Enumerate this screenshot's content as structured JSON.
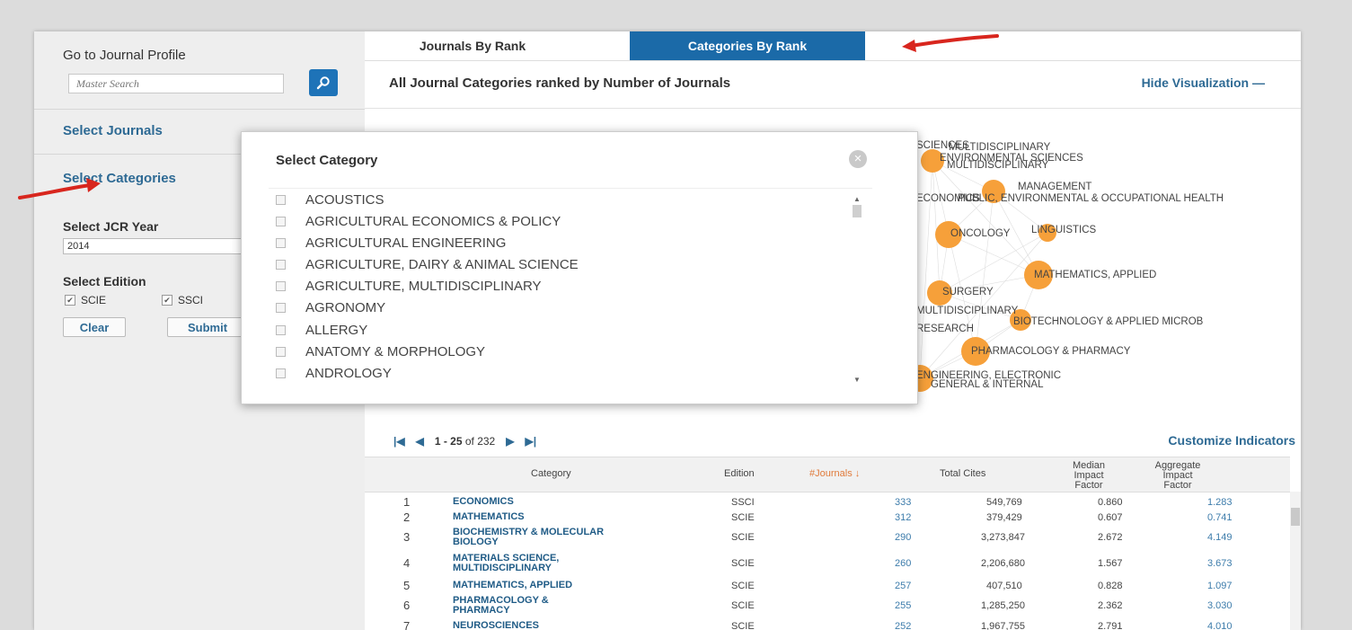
{
  "sidebar": {
    "go_to_profile": "Go to Journal Profile",
    "search_placeholder": "Master Search",
    "select_journals": "Select Journals",
    "select_categories": "Select Categories",
    "select_year_label": "Select JCR Year",
    "year_value": "2014",
    "select_edition_label": "Select Edition",
    "editions": [
      {
        "label": "SCIE",
        "checked": true
      },
      {
        "label": "SSCI",
        "checked": true
      }
    ],
    "clear_label": "Clear",
    "submit_label": "Submit"
  },
  "tabs": [
    {
      "label": "Journals By Rank",
      "active": false
    },
    {
      "label": "Categories By Rank",
      "active": true
    }
  ],
  "main": {
    "title": "All Journal Categories ranked by Number of Journals",
    "hide_visualization": "Hide Visualization —",
    "customize_indicators": "Customize Indicators"
  },
  "pager": {
    "range": "1 - 25",
    "of": "of 232"
  },
  "viz_labels": [
    "SCIENCES",
    "MULTIDISCIPLINARY",
    "ENVIRONMENTAL SCIENCES",
    "MULTIDISCIPLINARY",
    "MANAGEMENT",
    "ECONOMICS",
    "PUBLIC, ENVIRONMENTAL & OCCUPATIONAL HEALTH",
    "ONCOLOGY",
    "LINGUISTICS",
    "MATHEMATICS, APPLIED",
    "SURGERY",
    "MULTIDISCIPLINARY",
    "BIOTECHNOLOGY & APPLIED MICROB",
    "RESEARCH",
    "PHARMACOLOGY & PHARMACY",
    "ENGINEERING, ELECTRONIC",
    "GENERAL & INTERNAL"
  ],
  "table": {
    "headers": {
      "category": "Category",
      "edition": "Edition",
      "journals": "#Journals ↓",
      "total_cites": "Total Cites",
      "median_if": "Median Impact Factor",
      "aggregate_if": "Aggregate Impact Factor"
    },
    "rows": [
      {
        "rank": "1",
        "category": "ECONOMICS",
        "edition": "SSCI",
        "journals": "333",
        "total_cites": "549,769",
        "median": "0.860",
        "aggregate": "1.283"
      },
      {
        "rank": "2",
        "category": "MATHEMATICS",
        "edition": "SCIE",
        "journals": "312",
        "total_cites": "379,429",
        "median": "0.607",
        "aggregate": "0.741"
      },
      {
        "rank": "3",
        "category": "BIOCHEMISTRY & MOLECULAR BIOLOGY",
        "edition": "SCIE",
        "journals": "290",
        "total_cites": "3,273,847",
        "median": "2.672",
        "aggregate": "4.149"
      },
      {
        "rank": "4",
        "category": "MATERIALS SCIENCE, MULTIDISCIPLINARY",
        "edition": "SCIE",
        "journals": "260",
        "total_cites": "2,206,680",
        "median": "1.567",
        "aggregate": "3.673"
      },
      {
        "rank": "5",
        "category": "MATHEMATICS, APPLIED",
        "edition": "SCIE",
        "journals": "257",
        "total_cites": "407,510",
        "median": "0.828",
        "aggregate": "1.097"
      },
      {
        "rank": "6",
        "category": "PHARMACOLOGY & PHARMACY",
        "edition": "SCIE",
        "journals": "255",
        "total_cites": "1,285,250",
        "median": "2.362",
        "aggregate": "3.030"
      },
      {
        "rank": "7",
        "category": "NEUROSCIENCES",
        "edition": "SCIE",
        "journals": "252",
        "total_cites": "1,967,755",
        "median": "2.791",
        "aggregate": "4.010"
      }
    ]
  },
  "popup": {
    "title": "Select Category",
    "categories": [
      "ACOUSTICS",
      "AGRICULTURAL ECONOMICS & POLICY",
      "AGRICULTURAL ENGINEERING",
      "AGRICULTURE, DAIRY & ANIMAL SCIENCE",
      "AGRICULTURE, MULTIDISCIPLINARY",
      "AGRONOMY",
      "ALLERGY",
      "ANATOMY & MORPHOLOGY",
      "ANDROLOGY"
    ]
  },
  "colors": {
    "accent": "#1e73b8",
    "link": "#2e6a94",
    "node": "#f6a03a",
    "arrow": "#d8261e"
  }
}
